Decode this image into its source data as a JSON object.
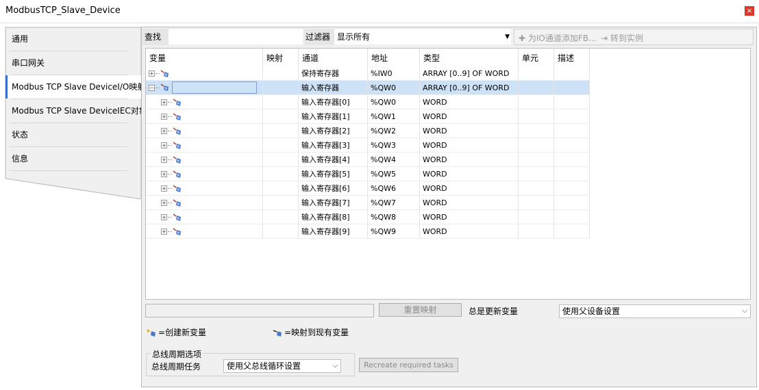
{
  "window": {
    "title": "ModbusTCP_Slave_Device",
    "close_label": "×"
  },
  "tabs": [
    {
      "label": "通用",
      "active": false
    },
    {
      "label": "串口网关",
      "active": false
    },
    {
      "label": "Modbus TCP Slave DeviceI/O映射",
      "active": true
    },
    {
      "label": "Modbus TCP Slave DeviceIEC对象",
      "active": false
    },
    {
      "label": "状态",
      "active": false
    },
    {
      "label": "信息",
      "active": false
    }
  ],
  "toolbar": {
    "find_label": "查找",
    "find_value": "",
    "filter_label": "过滤器",
    "filter_value": "显示所有",
    "add_fb_label": "为IO通道添加FB...",
    "goto_label": "转到实例"
  },
  "grid": {
    "columns": [
      "变量",
      "映射",
      "通道",
      "地址",
      "类型",
      "单元",
      "描述"
    ],
    "rows": [
      {
        "expander": "+",
        "indent": 0,
        "editing": false,
        "mapping": "",
        "channel": "保持寄存器",
        "address": "%IW0",
        "type": "ARRAY [0..9] OF WORD",
        "unit": "",
        "desc": ""
      },
      {
        "expander": "−",
        "indent": 0,
        "editing": true,
        "mapping": "",
        "channel": "输入寄存器",
        "address": "%QW0",
        "type": "ARRAY [0..9] OF WORD",
        "unit": "",
        "desc": ""
      },
      {
        "expander": "+",
        "indent": 1,
        "editing": false,
        "mapping": "",
        "channel": "输入寄存器[0]",
        "address": "%QW0",
        "type": "WORD",
        "unit": "",
        "desc": ""
      },
      {
        "expander": "+",
        "indent": 1,
        "editing": false,
        "mapping": "",
        "channel": "输入寄存器[1]",
        "address": "%QW1",
        "type": "WORD",
        "unit": "",
        "desc": ""
      },
      {
        "expander": "+",
        "indent": 1,
        "editing": false,
        "mapping": "",
        "channel": "输入寄存器[2]",
        "address": "%QW2",
        "type": "WORD",
        "unit": "",
        "desc": ""
      },
      {
        "expander": "+",
        "indent": 1,
        "editing": false,
        "mapping": "",
        "channel": "输入寄存器[3]",
        "address": "%QW3",
        "type": "WORD",
        "unit": "",
        "desc": ""
      },
      {
        "expander": "+",
        "indent": 1,
        "editing": false,
        "mapping": "",
        "channel": "输入寄存器[4]",
        "address": "%QW4",
        "type": "WORD",
        "unit": "",
        "desc": ""
      },
      {
        "expander": "+",
        "indent": 1,
        "editing": false,
        "mapping": "",
        "channel": "输入寄存器[5]",
        "address": "%QW5",
        "type": "WORD",
        "unit": "",
        "desc": ""
      },
      {
        "expander": "+",
        "indent": 1,
        "editing": false,
        "mapping": "",
        "channel": "输入寄存器[6]",
        "address": "%QW6",
        "type": "WORD",
        "unit": "",
        "desc": ""
      },
      {
        "expander": "+",
        "indent": 1,
        "editing": false,
        "mapping": "",
        "channel": "输入寄存器[7]",
        "address": "%QW7",
        "type": "WORD",
        "unit": "",
        "desc": ""
      },
      {
        "expander": "+",
        "indent": 1,
        "editing": false,
        "mapping": "",
        "channel": "输入寄存器[8]",
        "address": "%QW8",
        "type": "WORD",
        "unit": "",
        "desc": ""
      },
      {
        "expander": "+",
        "indent": 1,
        "editing": false,
        "mapping": "",
        "channel": "输入寄存器[9]",
        "address": "%QW9",
        "type": "WORD",
        "unit": "",
        "desc": ""
      }
    ]
  },
  "controls": {
    "reset_mapping": "重置映射",
    "always_update_label": "总是更新变量",
    "always_update_value": "使用父设备设置",
    "legend_new": "=创建新变量",
    "legend_map": "=映射到现有变量",
    "bus_group_title": "总线周期选项",
    "bus_task_label": "总线周期任务",
    "bus_task_value": "使用父总线循环设置",
    "recreate_tasks": "Recreate required tasks"
  },
  "colors": {
    "selection": "#cde1f7",
    "active_tab_accent": "#3a6fd0",
    "close_button": "#d9382a"
  }
}
